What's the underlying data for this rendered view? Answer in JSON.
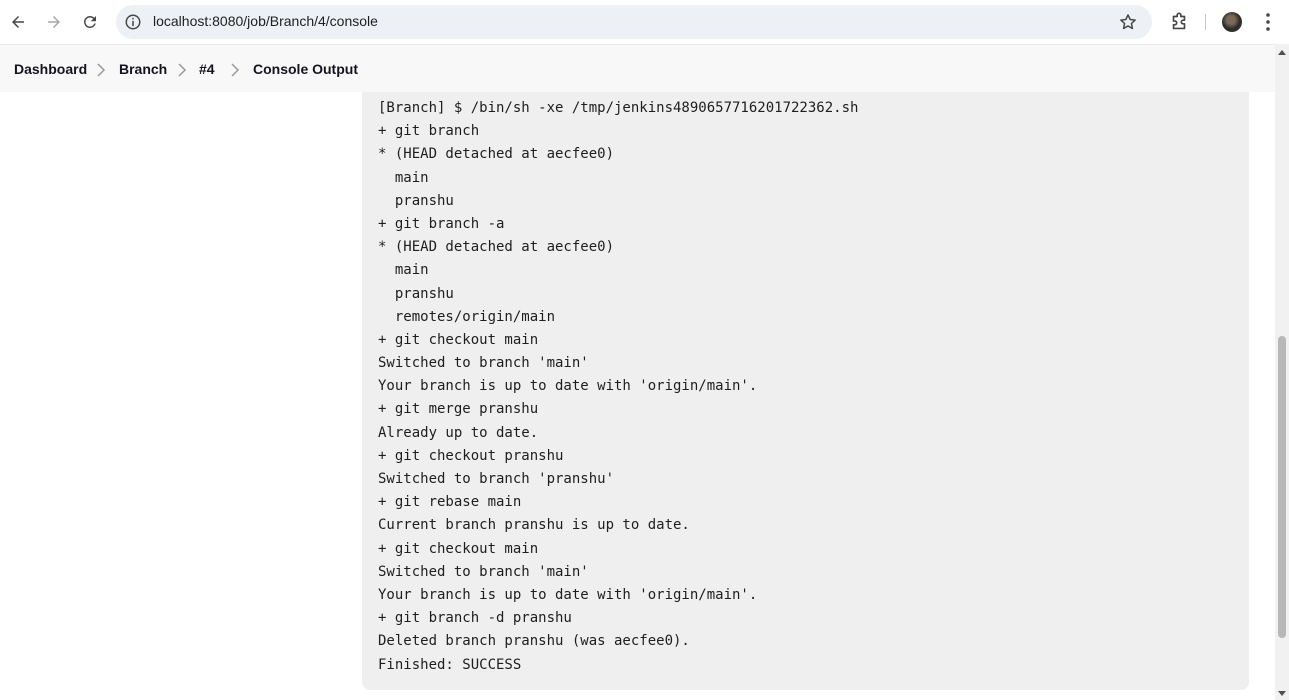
{
  "browser": {
    "url": "localhost:8080/job/Branch/4/console"
  },
  "breadcrumb": {
    "items": [
      "Dashboard",
      "Branch",
      "#4",
      "Console Output"
    ]
  },
  "console": {
    "lines": [
      "[Branch] $ /bin/sh -xe /tmp/jenkins4890657716201722362.sh",
      "+ git branch",
      "* (HEAD detached at aecfee0)",
      "  main",
      "  pranshu",
      "+ git branch -a",
      "* (HEAD detached at aecfee0)",
      "  main",
      "  pranshu",
      "  remotes/origin/main",
      "+ git checkout main",
      "Switched to branch 'main'",
      "Your branch is up to date with 'origin/main'.",
      "+ git merge pranshu",
      "Already up to date.",
      "+ git checkout pranshu",
      "Switched to branch 'pranshu'",
      "+ git rebase main",
      "Current branch pranshu is up to date.",
      "+ git checkout main",
      "Switched to branch 'main'",
      "Your branch is up to date with 'origin/main'.",
      "+ git branch -d pranshu",
      "Deleted branch pranshu (was aecfee0).",
      "Finished: SUCCESS"
    ]
  },
  "colors": {
    "console_bg": "#efefef",
    "breadcrumb_bg": "#f8f8f8",
    "omnibox_bg": "#edf1f6",
    "text": "#1e1e1e"
  }
}
